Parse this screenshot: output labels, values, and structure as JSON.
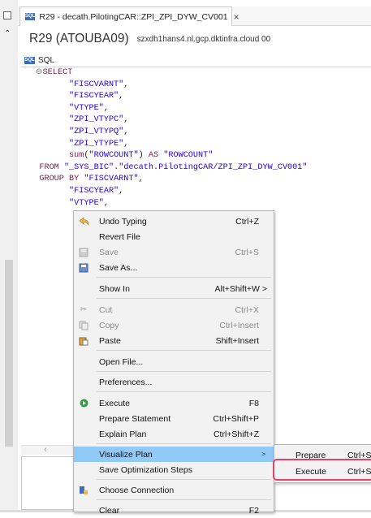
{
  "window": {
    "tab_title": "R29 - decath.PilotingCAR::ZPI_ZPI_DYW_CV001",
    "tab_close": "×",
    "tab_badge": "SQL"
  },
  "header": {
    "system": "R29 (ATOUBA09)",
    "host": "szxdh1hans4.nl.gcp.dktinfra.cloud 00"
  },
  "sql_panel": {
    "tab_label": "SQL",
    "badge": "SQL"
  },
  "code_lines": [
    [
      {
        "t": "SELECT",
        "c": "kw"
      }
    ],
    [
      {
        "t": "      "
      },
      {
        "t": "\"FISCVARNT\"",
        "c": "str"
      },
      {
        "t": ","
      }
    ],
    [
      {
        "t": "      "
      },
      {
        "t": "\"FISCYEAR\"",
        "c": "str"
      },
      {
        "t": ","
      }
    ],
    [
      {
        "t": "      "
      },
      {
        "t": "\"VTYPE\"",
        "c": "str"
      },
      {
        "t": ","
      }
    ],
    [
      {
        "t": "      "
      },
      {
        "t": "\"ZPI_VTYPC\"",
        "c": "str"
      },
      {
        "t": ","
      }
    ],
    [
      {
        "t": "      "
      },
      {
        "t": "\"ZPI_VTYPQ\"",
        "c": "str"
      },
      {
        "t": ","
      }
    ],
    [
      {
        "t": "      "
      },
      {
        "t": "\"ZPI_YTYPE\"",
        "c": "str"
      },
      {
        "t": ","
      }
    ],
    [
      {
        "t": "      "
      },
      {
        "t": "sum",
        "c": "kw"
      },
      {
        "t": "("
      },
      {
        "t": "\"ROWCOUNT\"",
        "c": "str"
      },
      {
        "t": ") "
      },
      {
        "t": "AS",
        "c": "kw"
      },
      {
        "t": " "
      },
      {
        "t": "\"ROWCOUNT\"",
        "c": "str"
      }
    ],
    [
      {
        "t": "FROM",
        "c": "kw"
      },
      {
        "t": " "
      },
      {
        "t": "\"_SYS_BIC\"",
        "c": "str"
      },
      {
        "t": "."
      },
      {
        "t": "\"decath.PilotingCAR/ZPI_ZPI_DYW_CV001\"",
        "c": "str"
      }
    ],
    [
      {
        "t": "GROUP BY",
        "c": "kw"
      },
      {
        "t": " "
      },
      {
        "t": "\"FISCVARNT\"",
        "c": "str"
      },
      {
        "t": ","
      }
    ],
    [
      {
        "t": "      "
      },
      {
        "t": "\"FISCYEAR\"",
        "c": "str"
      },
      {
        "t": ","
      }
    ],
    [
      {
        "t": "      "
      },
      {
        "t": "\"VTYPE\"",
        "c": "str"
      },
      {
        "t": ","
      }
    ]
  ],
  "menu": {
    "undo": {
      "label": "Undo Typing",
      "shortcut": "Ctrl+Z"
    },
    "revert": {
      "label": "Revert File"
    },
    "save": {
      "label": "Save",
      "shortcut": "Ctrl+S"
    },
    "save_as": {
      "label": "Save As..."
    },
    "show_in": {
      "label": "Show In",
      "shortcut": "Alt+Shift+W >"
    },
    "cut": {
      "label": "Cut",
      "shortcut": "Ctrl+X"
    },
    "copy": {
      "label": "Copy",
      "shortcut": "Ctrl+Insert"
    },
    "paste": {
      "label": "Paste",
      "shortcut": "Shift+Insert"
    },
    "open_file": {
      "label": "Open File..."
    },
    "preferences": {
      "label": "Preferences..."
    },
    "execute": {
      "label": "Execute",
      "shortcut": "F8"
    },
    "prepare": {
      "label": "Prepare Statement",
      "shortcut": "Ctrl+Shift+P"
    },
    "explain": {
      "label": "Explain Plan",
      "shortcut": "Ctrl+Shift+Z"
    },
    "visualize": {
      "label": "Visualize Plan",
      "arrow": ">"
    },
    "save_opt": {
      "label": "Save Optimization Steps"
    },
    "choose_conn": {
      "label": "Choose Connection"
    },
    "clear": {
      "label": "Clear",
      "shortcut": "F2"
    }
  },
  "submenu": {
    "prepare": {
      "label": "Prepare",
      "shortcut": "Ctrl+S"
    },
    "execute": {
      "label": "Execute",
      "shortcut": "Ctrl+S"
    }
  },
  "colors": {
    "highlight": "#91c9f7",
    "callout": "#e0426a",
    "keyword": "#7b1d4d",
    "string": "#2a00cc"
  }
}
